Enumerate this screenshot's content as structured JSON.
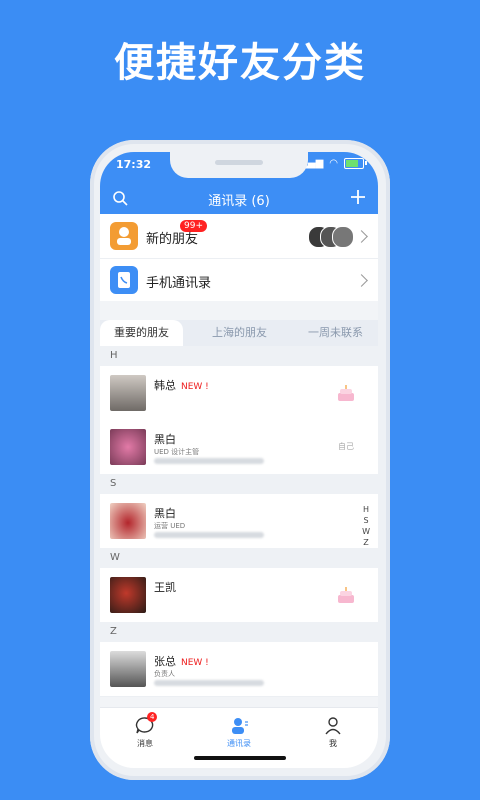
{
  "headline": "便捷好友分类",
  "status": {
    "time": "17:32"
  },
  "nav": {
    "title": "通讯录 (6)"
  },
  "top_rows": [
    {
      "label": "新的朋友",
      "badge": "99+"
    },
    {
      "label": "手机通讯录"
    }
  ],
  "tabs": [
    "重要的朋友",
    "上海的朋友",
    "一周未联系"
  ],
  "sections": [
    {
      "letter": "H"
    },
    {
      "letter": "S"
    },
    {
      "letter": "W"
    },
    {
      "letter": "Z"
    }
  ],
  "contacts": [
    {
      "name": "韩总",
      "new": "NEW !",
      "role": ""
    },
    {
      "name": "黑白",
      "new": "",
      "role": "UED 设计主管",
      "tag": "自己"
    },
    {
      "name": "黑白",
      "new": "",
      "role": "运营 UED"
    },
    {
      "name": "王凯",
      "new": "",
      "role": ""
    },
    {
      "name": "张总",
      "new": "NEW !",
      "role": "负责人"
    }
  ],
  "index": [
    "H",
    "S",
    "W",
    "Z"
  ],
  "tabbar": [
    {
      "label": "消息",
      "badge": "4"
    },
    {
      "label": "通讯录"
    },
    {
      "label": "我"
    }
  ],
  "colors": {
    "brand": "#3d8ef5",
    "background": "#3b8df4",
    "badge": "#ff2222",
    "new": "#ee1d1d"
  }
}
